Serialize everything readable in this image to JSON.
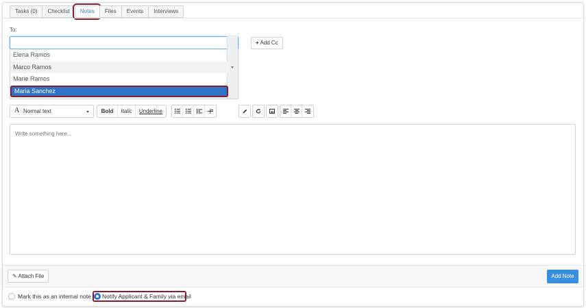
{
  "tabs": [
    {
      "label": "Tasks (0)"
    },
    {
      "label": "Checklist"
    },
    {
      "label": "Notes",
      "active": true
    },
    {
      "label": "Files"
    },
    {
      "label": "Events"
    },
    {
      "label": "Interviews"
    }
  ],
  "recipients": {
    "label": "To:",
    "input_value": "",
    "options": [
      {
        "label": "Elena Ramos"
      },
      {
        "label": "Marco Ramos"
      },
      {
        "label": "Marie Ramos"
      },
      {
        "label": "Maria Sanchez",
        "selected": true
      }
    ],
    "add_cc_label": "Add Cc"
  },
  "toolbar": {
    "text_style": "Normal text",
    "bold": "Bold",
    "italic": "Italic",
    "underline": "Underline",
    "icons": [
      "unordered-list-icon",
      "ordered-list-icon",
      "indent-icon",
      "outdent-icon",
      "pen-icon",
      "redo-icon",
      "image-icon",
      "align-left-icon",
      "align-center-icon",
      "align-right-icon"
    ]
  },
  "editor": {
    "placeholder": "Write something here..."
  },
  "footer": {
    "attach_label": "Attach File",
    "add_note_label": "Add Note",
    "internal_note_label": "Mark this as an internal note or",
    "notify_label": "Notify Applicant & Family via email",
    "notify_checked": true
  },
  "colors": {
    "accent": "#3b8fe0",
    "selected": "#2f73c9",
    "highlight_outline": "#8a1e2c"
  }
}
